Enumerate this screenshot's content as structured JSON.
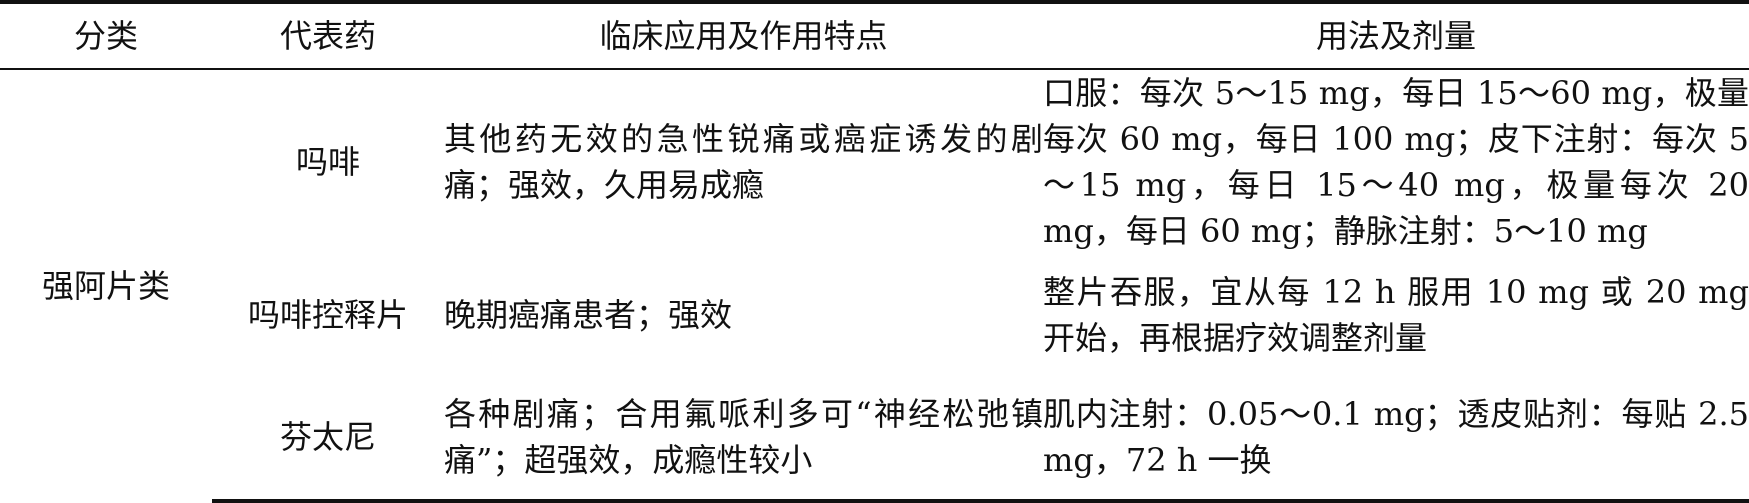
{
  "table": {
    "headers": [
      "分类",
      "代表药",
      "临床应用及作用特点",
      "用法及剂量"
    ],
    "category": "强阿片类",
    "rows": [
      {
        "drug": "吗啡",
        "use": "其他药无效的急性锐痛或癌症诱发的剧痛；强效，久用易成瘾",
        "dose": "口服：每次 5～15 mg，每日 15～60 mg，极量每次 60 mg，每日 100 mg；皮下注射：每次 5～15 mg，每日 15～40 mg，极量每次 20 mg，每日 60 mg；静脉注射：5～10 mg"
      },
      {
        "drug": "吗啡控释片",
        "use": "晚期癌痛患者；强效",
        "dose": "整片吞服，宜从每 12 h 服用 10 mg 或 20 mg 开始，再根据疗效调整剂量"
      },
      {
        "drug": "芬太尼",
        "use": "各种剧痛；合用氟哌利多可“神经松弛镇痛”；超强效，成瘾性较小",
        "dose": "肌内注射：0.05～0.1 mg；透皮贴剂：每贴 2.5 mg，72 h 一换"
      }
    ]
  }
}
